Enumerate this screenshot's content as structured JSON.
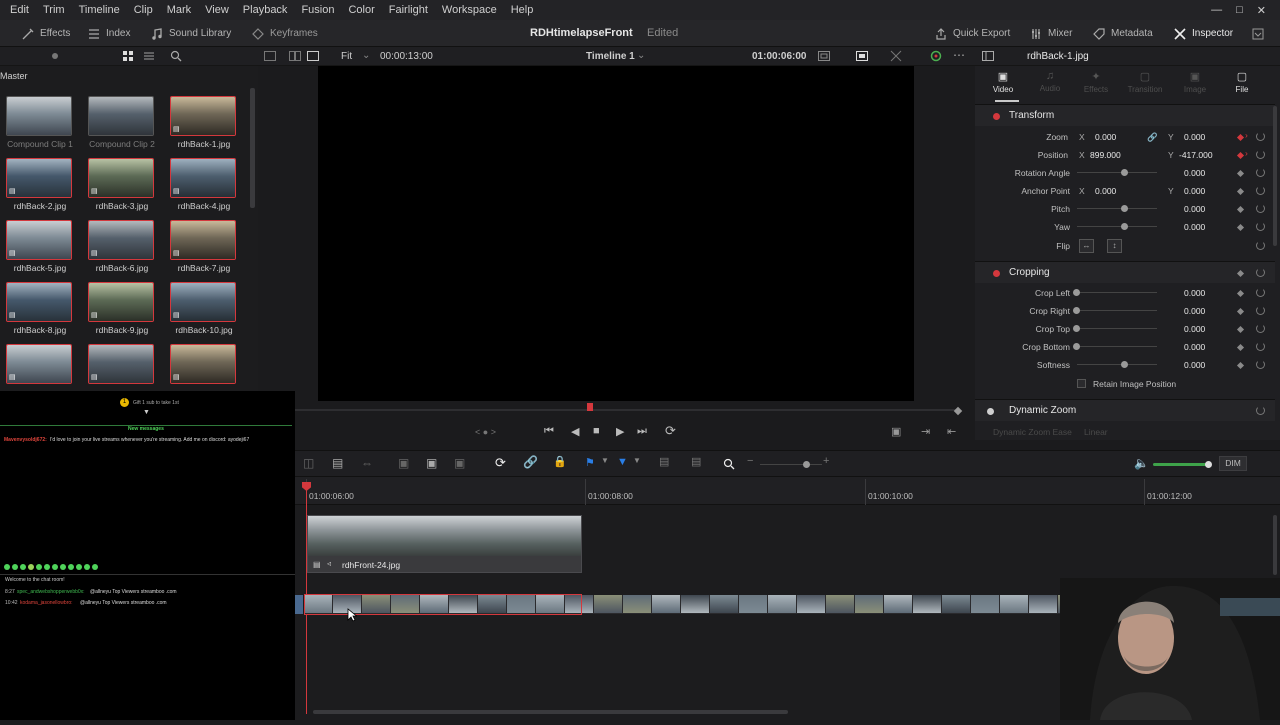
{
  "menu": [
    "Edit",
    "Trim",
    "Timeline",
    "Clip",
    "Mark",
    "View",
    "Playback",
    "Fusion",
    "Color",
    "Fairlight",
    "Workspace",
    "Help"
  ],
  "toolbar": {
    "effects": "Effects",
    "index": "Index",
    "sound_library": "Sound Library",
    "keyframes": "Keyframes",
    "project_title": "RDHtimelapseFront",
    "project_status": "Edited",
    "quick_export": "Quick Export",
    "mixer": "Mixer",
    "metadata": "Metadata",
    "inspector": "Inspector"
  },
  "subbar": {
    "fit": "Fit",
    "duration": "00:00:13:00",
    "timeline_name": "Timeline 1",
    "timecode": "01:00:06:00",
    "clip_name": "rdhBack-1.jpg"
  },
  "media_pool": {
    "title": "Master",
    "items": [
      {
        "label": "Compound Clip 1",
        "dim": true
      },
      {
        "label": "Compound Clip 2",
        "dim": true
      },
      {
        "label": "rdhBack-1.jpg",
        "dim": false
      },
      {
        "label": "rdhBack-2.jpg",
        "dim": false
      },
      {
        "label": "rdhBack-3.jpg",
        "dim": false
      },
      {
        "label": "rdhBack-4.jpg",
        "dim": false
      },
      {
        "label": "rdhBack-5.jpg",
        "dim": false
      },
      {
        "label": "rdhBack-6.jpg",
        "dim": false
      },
      {
        "label": "rdhBack-7.jpg",
        "dim": false
      },
      {
        "label": "rdhBack-8.jpg",
        "dim": false
      },
      {
        "label": "rdhBack-9.jpg",
        "dim": false
      },
      {
        "label": "rdhBack-10.jpg",
        "dim": false
      },
      {
        "label": "",
        "dim": false
      },
      {
        "label": "",
        "dim": false
      },
      {
        "label": "",
        "dim": false
      }
    ]
  },
  "chat": {
    "badge": "1",
    "sub_line": "Gift 1 sub to take 1st",
    "new_messages": "New messages",
    "message_user": "Mavenvysoldj672:",
    "message_text": "I'd love to join your live streams whenever you're streaming. Add me on discord: ayodeji67",
    "welcome": "Welcome to the chat room!",
    "line1_time": "8:27",
    "line1_user": "spec_andwebshopperwebb0x:",
    "line1_text": "@allneyu Top Viewers streamboo .com",
    "line2_time": "10:42",
    "line2_user": "kodama_jasonellowbro:",
    "line2_text": "@allneyu Top Viewers streamboo .com"
  },
  "inspector": {
    "tabs": [
      "Video",
      "Audio",
      "Effects",
      "Transition",
      "Image",
      "File"
    ],
    "transform": "Transform",
    "zoom_label": "Zoom",
    "zoom_x": "0.000",
    "zoom_y": "0.000",
    "position_label": "Position",
    "position_x": "899.000",
    "position_y": "-417.000",
    "rotation_label": "Rotation Angle",
    "rotation": "0.000",
    "anchor_label": "Anchor Point",
    "anchor_x": "0.000",
    "anchor_y": "0.000",
    "pitch_label": "Pitch",
    "pitch": "0.000",
    "yaw_label": "Yaw",
    "yaw": "0.000",
    "flip_label": "Flip",
    "x": "X",
    "y": "Y",
    "cropping": "Cropping",
    "crop_left_label": "Crop Left",
    "crop_left": "0.000",
    "crop_right_label": "Crop Right",
    "crop_right": "0.000",
    "crop_top_label": "Crop Top",
    "crop_top": "0.000",
    "crop_bottom_label": "Crop Bottom",
    "crop_bottom": "0.000",
    "softness_label": "Softness",
    "softness": "0.000",
    "retain": "Retain Image Position",
    "dynamic_zoom": "Dynamic Zoom",
    "dz_ease_label": "Dynamic Zoom Ease",
    "dz_ease_value": "Linear"
  },
  "timeline": {
    "ruler": [
      "01:00:06:00",
      "01:00:08:00",
      "01:00:10:00",
      "01:00:12:00"
    ],
    "clip_label": "rdhFront-24.jpg",
    "dim": "DIM"
  },
  "colors": {
    "accent_red": "#d4383d",
    "panel": "#1f1f22",
    "viewer_bg": "#000000"
  }
}
